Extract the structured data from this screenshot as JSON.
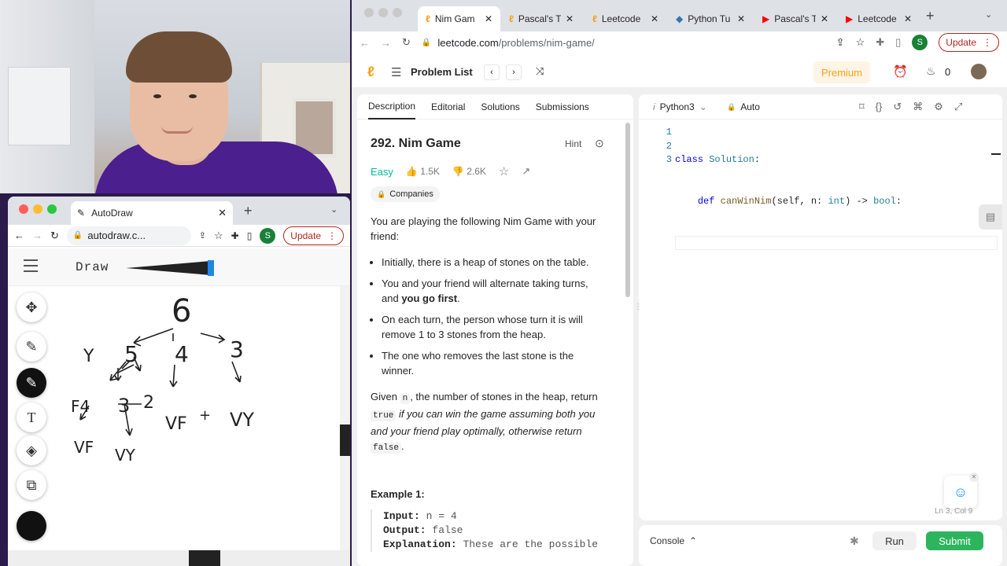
{
  "autodraw_window": {
    "tab_title": "AutoDraw",
    "url": "autodraw.c...",
    "avatar_initial": "S",
    "update_label": "Update",
    "app_title": "Draw",
    "drawing_numbers": [
      "6",
      "5",
      "4",
      "3",
      "3",
      "2",
      "F4",
      "VF",
      "VF",
      "+",
      "VY",
      "Y",
      "VY"
    ]
  },
  "chrome": {
    "tabs": [
      {
        "label": "Nim Gam",
        "icon": "leetcode-icon"
      },
      {
        "label": "Pascal's T",
        "icon": "leetcode-icon"
      },
      {
        "label": "Leetcode",
        "icon": "leetcode-icon"
      },
      {
        "label": "Python Tu",
        "icon": "python-icon"
      },
      {
        "label": "Pascal's T",
        "icon": "youtube-icon"
      },
      {
        "label": "Leetcode",
        "icon": "youtube-icon"
      }
    ],
    "url_domain": "leetcode.com",
    "url_path": "/problems/nim-game/",
    "avatar_initial": "S",
    "update_label": "Update"
  },
  "header": {
    "problem_list": "Problem List",
    "premium": "Premium",
    "streak": "0"
  },
  "description": {
    "tabs": [
      "Description",
      "Editorial",
      "Solutions",
      "Submissions"
    ],
    "title": "292. Nim Game",
    "hint": "Hint",
    "difficulty": "Easy",
    "likes": "1.5K",
    "dislikes": "2.6K",
    "companies": "Companies",
    "intro": "You are playing the following Nim Game with your friend:",
    "bullets": [
      "Initially, there is a heap of stones on the table.",
      "You and your friend will alternate taking turns, and ",
      "On each turn, the person whose turn it is will remove 1 to 3 stones from the heap.",
      "The one who removes the last stone is the winner."
    ],
    "bullet2_bold": "you go first",
    "given_pre": "Given ",
    "given_n": "n",
    "given_mid": ", the number of stones in the heap, return ",
    "given_true": "true",
    "given_italic": " if you can win the game assuming both you and your friend play optimally, otherwise return ",
    "given_false": "false",
    "example_title": "Example 1:",
    "ex_input_label": "Input:",
    "ex_input_val": "n = 4",
    "ex_output_label": "Output:",
    "ex_output_val": "false",
    "ex_expl_label": "Explanation:",
    "ex_expl_val": "These are the possible"
  },
  "editor": {
    "language": "Python3",
    "autocomplete": "Auto",
    "line_numbers": [
      "1",
      "2",
      "3"
    ],
    "line1_kw": "class",
    "line1_name": "Solution",
    "line2_kw": "def",
    "line2_fn": "canWinNim",
    "line2_args_a": "(self, n: ",
    "line2_type": "int",
    "line2_arrow": ") -> ",
    "line2_ret": "bool",
    "status": "Ln 3, Col 9"
  },
  "console": {
    "label": "Console",
    "run": "Run",
    "submit": "Submit"
  },
  "colors": {
    "easy": "#00b8a3",
    "premium": "#ffa116",
    "submit": "#2db55d",
    "shirt": "#4b1f8e"
  }
}
